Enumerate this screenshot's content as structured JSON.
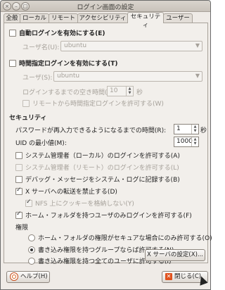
{
  "window": {
    "title": "ログイン画面の設定",
    "close_glyph": "×",
    "min_glyph": "–",
    "max_glyph": "□"
  },
  "tabs": [
    "全般",
    "ローカル",
    "リモート",
    "アクセシビリティ",
    "セキュリティ",
    "ユーザー"
  ],
  "active_tab": "セキュリティ",
  "auto_login": {
    "label": "自動ログインを有効にする(E)",
    "checked": false,
    "user_label": "ユーザ名(U):",
    "user_value": "ubuntu"
  },
  "timed_login": {
    "label": "時間指定ログインを有効にする(T)",
    "checked": false,
    "user_label": "ユーザ(S):",
    "user_value": "ubuntu",
    "wait_label": "ログインするまでの空き時間(P):",
    "wait_value": "10",
    "wait_unit": "秒",
    "remote_label": "リモートから時間指定ログインを許可する(W)",
    "remote_checked": false
  },
  "security": {
    "heading": "セキュリティ",
    "reenter_label": "パスワードが再入力できるようになるまでの時間(R):",
    "reenter_value": "1",
    "reenter_unit": "秒",
    "uid_label": "UID の最小値(M):",
    "uid_value": "1000",
    "options": [
      {
        "label": "システム管理者（ローカル）のログインを許可する(A)",
        "checked": false,
        "enabled": true
      },
      {
        "label": "システム管理者（リモート）のログインを許可する(L)",
        "checked": false,
        "enabled": false
      },
      {
        "label": "デバッグ・メッセージをシステム・ログに記録する(B)",
        "checked": false,
        "enabled": true
      },
      {
        "label": "X サーバへの転送を禁止する(D)",
        "checked": true,
        "enabled": true
      },
      {
        "label": "NFS 上にクッキーを格納しない(Y)",
        "checked": true,
        "enabled": false
      },
      {
        "label": "ホーム・フォルダを持つユーザのみログインを許可する(F)",
        "checked": true,
        "enabled": true
      }
    ],
    "perm_heading": "権限",
    "permissions": [
      {
        "label": "ホーム・フォルダの権限がセキュアな場合にのみ許可する(O)",
        "selected": false
      },
      {
        "label": "書き込み権限を持つグループならば許可する(N)",
        "selected": true
      },
      {
        "label": "書き込み権限を持つ全てのユーザに許可する(I)",
        "selected": false
      }
    ],
    "xserver_button": "X サーバの設定(X)..."
  },
  "footer": {
    "help_label": "ヘルプ(H)",
    "close_label": "閉じる(C)"
  }
}
